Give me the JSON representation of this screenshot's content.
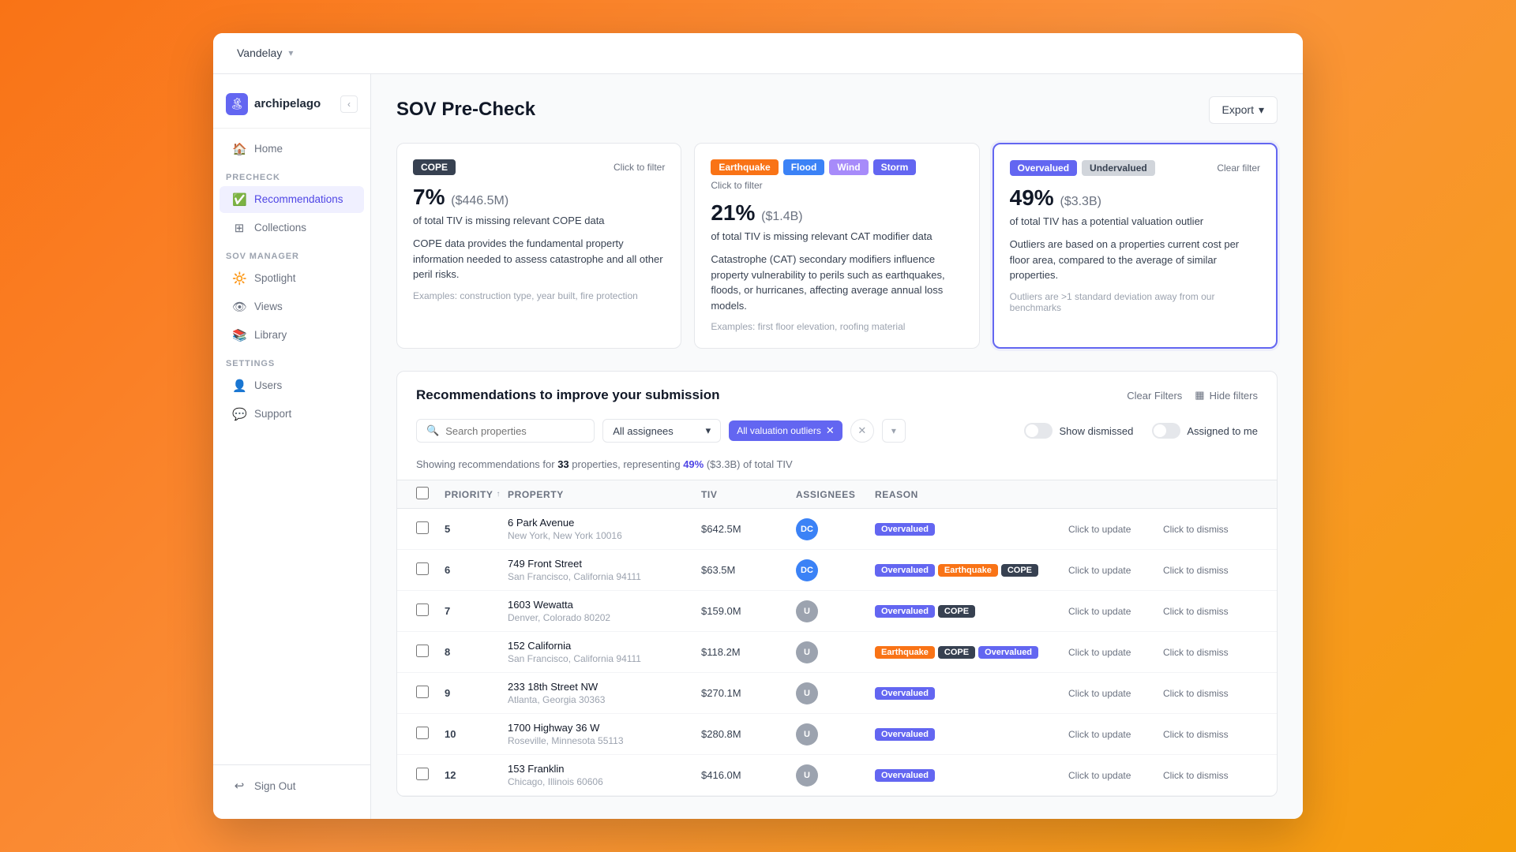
{
  "app": {
    "org": "Vandelay",
    "logo": "archipelago",
    "logo_char": "🏝"
  },
  "topbar": {
    "org_label": "Vandelay",
    "org_chevron": "▾"
  },
  "sidebar": {
    "logo_text": "archipelago",
    "home_label": "Home",
    "precheck_section": "PRECHECK",
    "recommendations_label": "Recommendations",
    "collections_label": "Collections",
    "sov_manager_section": "SOV MANAGER",
    "spotlight_label": "Spotlight",
    "views_label": "Views",
    "library_label": "Library",
    "settings_section": "SETTINGS",
    "users_label": "Users",
    "support_label": "Support",
    "sign_out_label": "Sign Out",
    "collapse_icon": "‹"
  },
  "page": {
    "title": "SOV Pre-Check",
    "export_label": "Export"
  },
  "cards": [
    {
      "id": "cope-card",
      "tags": [
        "COPE"
      ],
      "filter_link": "Click to filter",
      "stat": "7%",
      "stat_detail": "($446.5M)",
      "headline": "of total TIV is missing relevant COPE data",
      "desc": "COPE data provides the fundamental property information needed to assess catastrophe and all other peril risks.",
      "example": "Examples: construction type, year built, fire protection"
    },
    {
      "id": "cat-card",
      "tags": [
        "Earthquake",
        "Flood",
        "Wind",
        "Storm"
      ],
      "filter_link": "Click to filter",
      "stat": "21%",
      "stat_detail": "($1.4B)",
      "headline": "of total TIV is missing relevant CAT modifier data",
      "desc": "Catastrophe (CAT) secondary modifiers influence property vulnerability to perils such as earthquakes, floods, or hurricanes, affecting average annual loss models.",
      "example": "Examples: first floor elevation, roofing material"
    },
    {
      "id": "valuation-card",
      "tags": [
        "Overvalued",
        "Undervalued"
      ],
      "filter_link": "Clear filter",
      "stat": "49%",
      "stat_detail": "($3.3B)",
      "headline": "of total TIV has a potential valuation outlier",
      "desc": "Outliers are based on a properties current cost per floor area, compared to the average of similar properties.",
      "note": "Outliers are >1 standard deviation away from our benchmarks"
    }
  ],
  "recommendations": {
    "title": "Recommendations to improve your submission",
    "clear_filters": "Clear Filters",
    "hide_filters": "Hide filters",
    "search_placeholder": "Search properties",
    "assignee_select": "All assignees",
    "active_filter_chip": "All valuation outliers",
    "show_dismissed_label": "Show dismissed",
    "assigned_to_me_label": "Assigned to me",
    "showing_prefix": "Showing recommendations for",
    "showing_count": "33",
    "showing_unit": "properties, representing",
    "showing_pct": "49%",
    "showing_tiv": "($3.3B) of total TIV",
    "columns": [
      "Priority",
      "Property",
      "TIV",
      "Assignees",
      "Reason",
      "",
      ""
    ],
    "rows": [
      {
        "priority": 5,
        "property": "6 Park Avenue",
        "address": "New York, New York 10016",
        "tiv": "$642.5M",
        "assignee": "DC",
        "assignee_color": "blue",
        "reasons": [
          "Overvalued"
        ],
        "update": "Click to update",
        "dismiss": "Click to dismiss"
      },
      {
        "priority": 6,
        "property": "749 Front Street",
        "address": "San Francisco, California 94111",
        "tiv": "$63.5M",
        "assignee": "DC",
        "assignee_color": "blue",
        "reasons": [
          "Overvalued",
          "Earthquake",
          "COPE"
        ],
        "update": "Click to update",
        "dismiss": "Click to dismiss"
      },
      {
        "priority": 7,
        "property": "1603 Wewatta",
        "address": "Denver, Colorado 80202",
        "tiv": "$159.0M",
        "assignee": "U",
        "assignee_color": "gray",
        "reasons": [
          "Overvalued",
          "COPE"
        ],
        "update": "Click to update",
        "dismiss": "Click to dismiss"
      },
      {
        "priority": 8,
        "property": "152 California",
        "address": "San Francisco, California 94111",
        "tiv": "$118.2M",
        "assignee": "U",
        "assignee_color": "gray",
        "reasons": [
          "Earthquake",
          "COPE",
          "Overvalued"
        ],
        "update": "Click to update",
        "dismiss": "Click to dismiss"
      },
      {
        "priority": 9,
        "property": "233 18th Street NW",
        "address": "Atlanta, Georgia 30363",
        "tiv": "$270.1M",
        "assignee": "U",
        "assignee_color": "gray",
        "reasons": [
          "Overvalued"
        ],
        "update": "Click to update",
        "dismiss": "Click to dismiss"
      },
      {
        "priority": 10,
        "property": "1700 Highway 36 W",
        "address": "Roseville, Minnesota 55113",
        "tiv": "$280.8M",
        "assignee": "U",
        "assignee_color": "gray",
        "reasons": [
          "Overvalued"
        ],
        "update": "Click to update",
        "dismiss": "Click to dismiss"
      },
      {
        "priority": 12,
        "property": "153 Franklin",
        "address": "Chicago, Illinois 60606",
        "tiv": "$416.0M",
        "assignee": "U",
        "assignee_color": "gray",
        "reasons": [
          "Overvalued"
        ],
        "update": "Click to update",
        "dismiss": "Click to dismiss"
      }
    ]
  }
}
